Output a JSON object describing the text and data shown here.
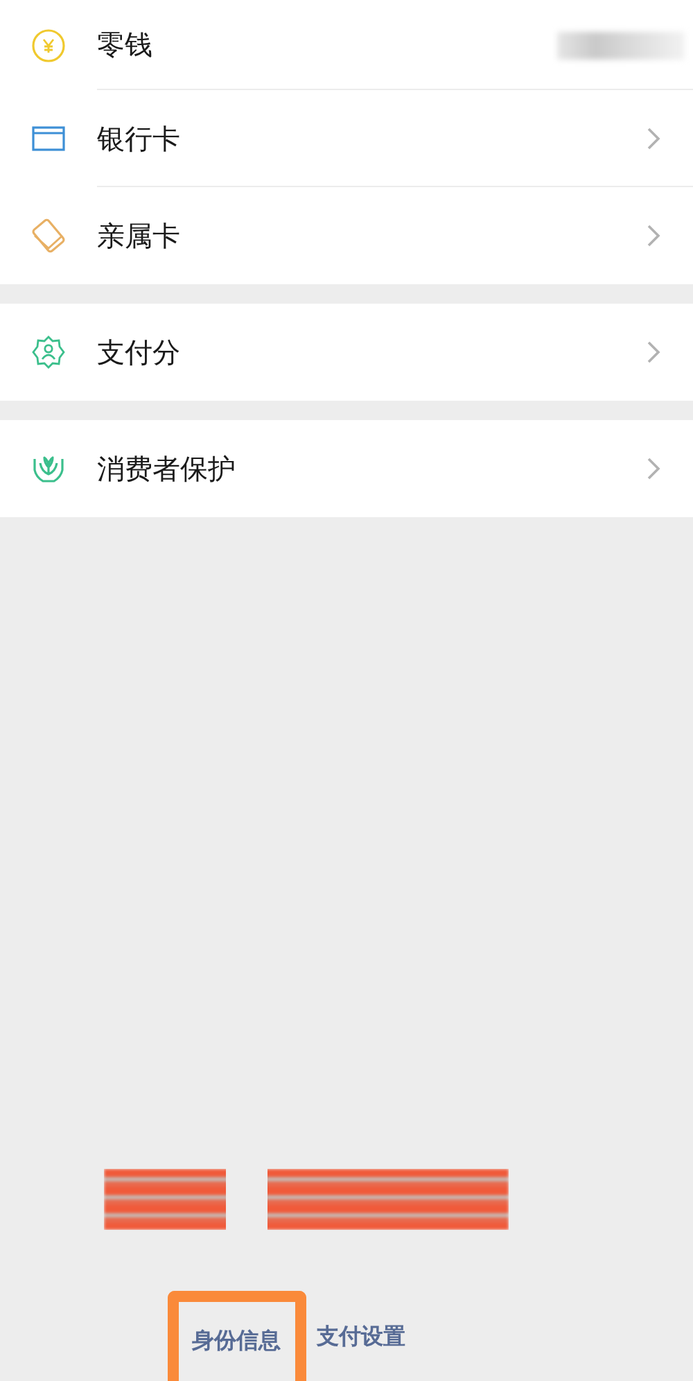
{
  "groups": [
    {
      "items": [
        {
          "label": "零钱",
          "kind": "balance"
        },
        {
          "label": "银行卡",
          "kind": "link"
        },
        {
          "label": "亲属卡",
          "kind": "link"
        }
      ]
    },
    {
      "items": [
        {
          "label": "支付分",
          "kind": "link"
        }
      ]
    },
    {
      "items": [
        {
          "label": "消费者保护",
          "kind": "link"
        }
      ]
    }
  ],
  "footer_links": [
    {
      "label": "身份信息",
      "highlighted": true
    },
    {
      "label": "支付设置",
      "highlighted": false
    }
  ]
}
